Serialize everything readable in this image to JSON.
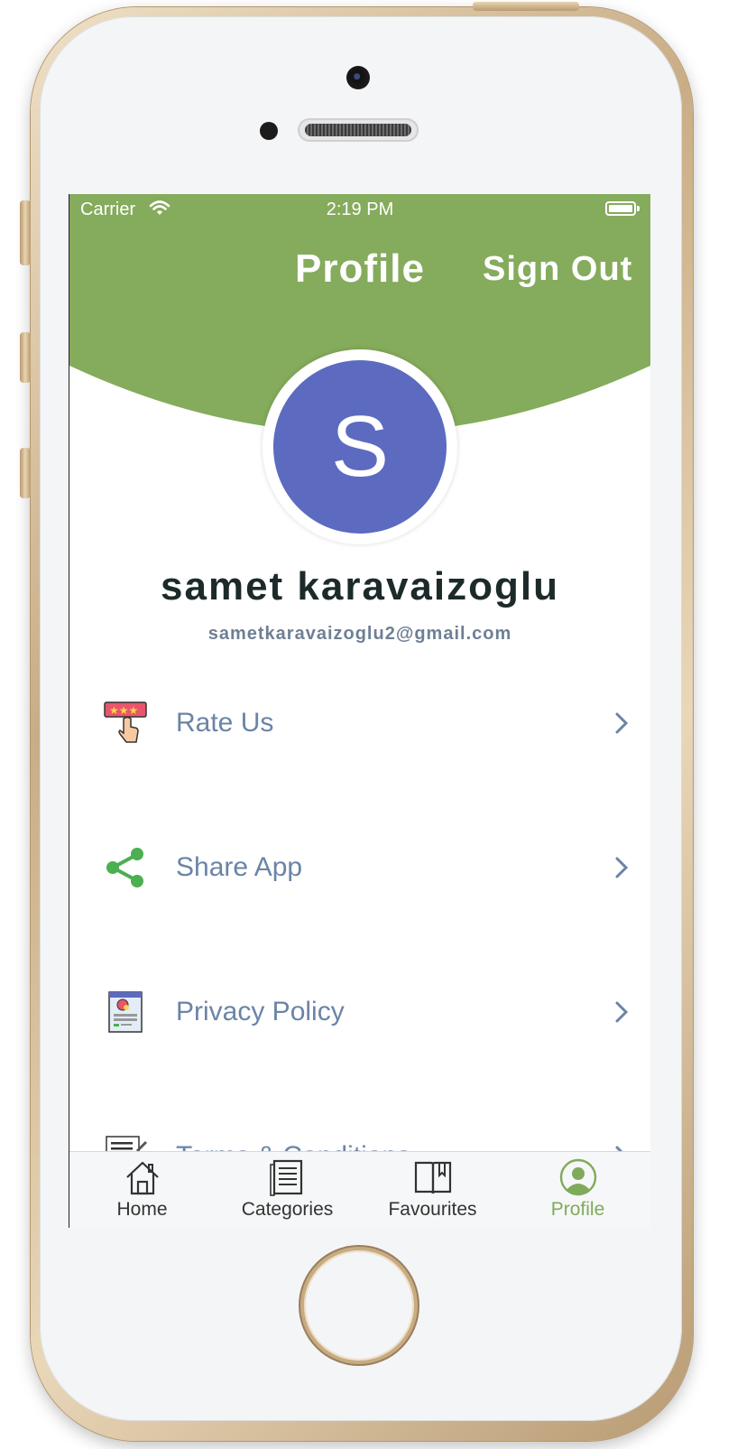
{
  "status_bar": {
    "carrier": "Carrier",
    "time": "2:19 PM"
  },
  "header": {
    "title": "Profile",
    "sign_out_label": "Sign Out",
    "color": "#85ab5c"
  },
  "profile": {
    "avatar_initial": "S",
    "avatar_color": "#5c6bc0",
    "name": "samet karavaizoglu",
    "email": "sametkaravaizoglu2@gmail.com"
  },
  "menu": {
    "items": [
      {
        "label": "Rate Us",
        "icon": "rate-stars-icon"
      },
      {
        "label": "Share App",
        "icon": "share-icon"
      },
      {
        "label": "Privacy Policy",
        "icon": "privacy-document-icon"
      },
      {
        "label": "Terms & Conditions",
        "icon": "terms-document-icon"
      }
    ]
  },
  "tab_bar": {
    "tabs": [
      {
        "label": "Home",
        "icon": "home-icon"
      },
      {
        "label": "Categories",
        "icon": "categories-icon"
      },
      {
        "label": "Favourites",
        "icon": "book-icon"
      },
      {
        "label": "Profile",
        "icon": "profile-icon",
        "active": true
      }
    ],
    "active_color": "#7faa5a"
  }
}
